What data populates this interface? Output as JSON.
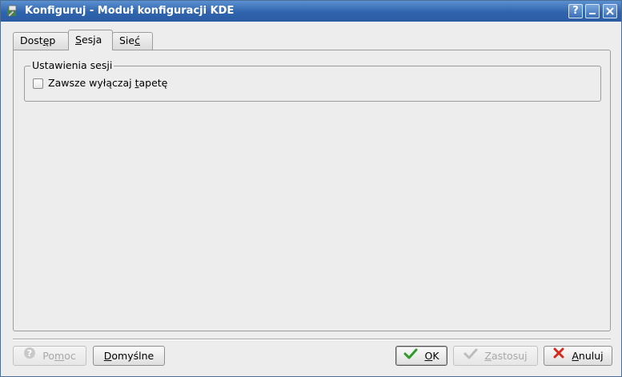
{
  "window": {
    "title": "Konfiguruj - Moduł konfiguracji KDE",
    "title_icon": "kde-config-icon",
    "controls": {
      "help": "?",
      "minimize": "–",
      "close": "✕"
    }
  },
  "tabs": [
    {
      "label_pre": "Dost",
      "label_u": "ę",
      "label_post": "p",
      "active": false
    },
    {
      "label_pre": "",
      "label_u": "S",
      "label_post": "esja",
      "active": true
    },
    {
      "label_pre": "Sie",
      "label_u": "ć",
      "label_post": "",
      "active": false
    }
  ],
  "session_group": {
    "title": "Ustawienia sesji",
    "checkbox": {
      "label_pre": "Zawsze wyłączaj ",
      "label_u": "t",
      "label_post": "apetę",
      "checked": false
    }
  },
  "buttons": {
    "help": {
      "pre": "Po",
      "u": "m",
      "post": "oc",
      "enabled": false
    },
    "defaults": {
      "pre": "",
      "u": "D",
      "post": "omyślne",
      "enabled": true
    },
    "ok": {
      "pre": "",
      "u": "O",
      "post": "K",
      "enabled": true
    },
    "apply": {
      "pre": "",
      "u": "Z",
      "post": "astosuj",
      "enabled": false
    },
    "cancel": {
      "pre": "",
      "u": "A",
      "post": "nuluj",
      "enabled": true
    }
  },
  "colors": {
    "titlebar": "#2f64ad",
    "ok_check": "#2f9a2a",
    "cancel_x": "#d42a1e"
  }
}
